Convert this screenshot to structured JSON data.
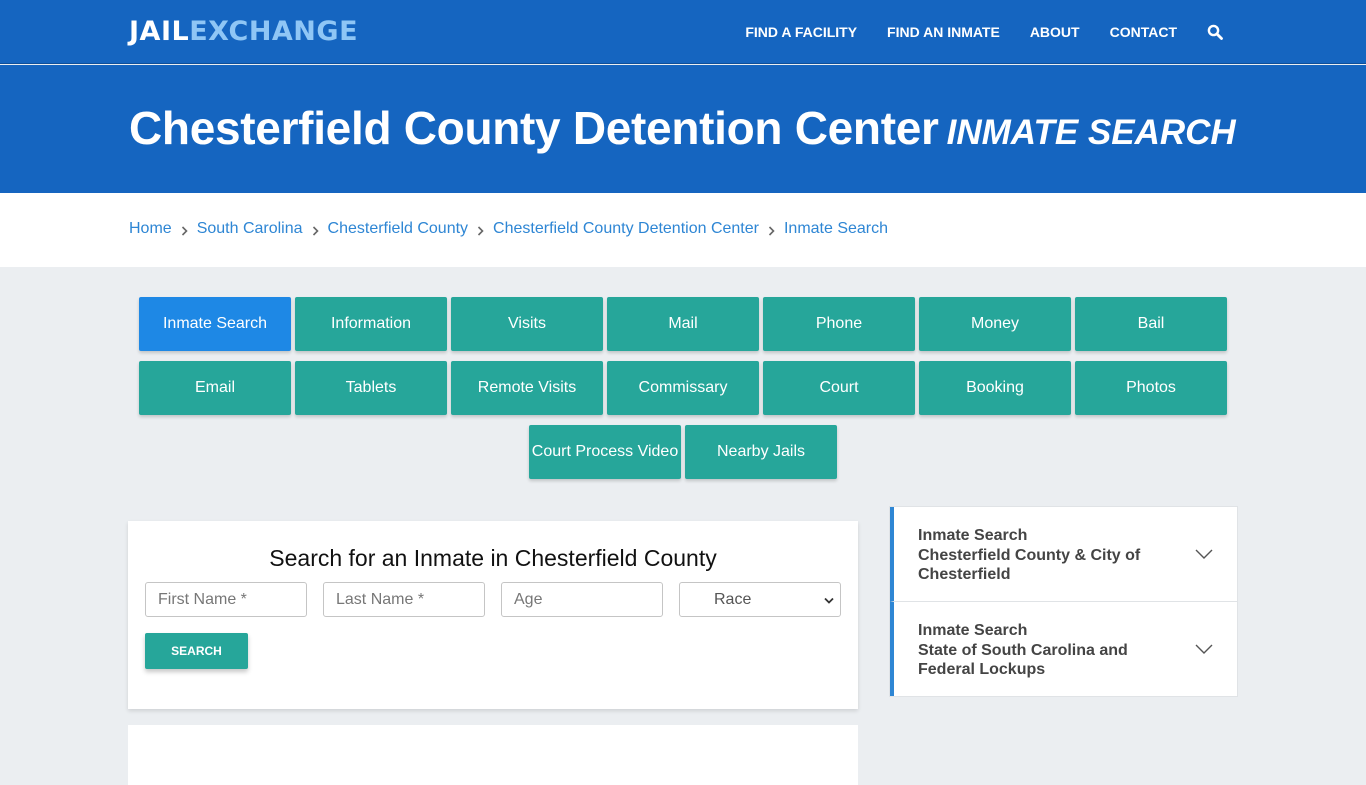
{
  "header": {
    "logo": {
      "part1": "JAIL",
      "part2": "EXCHANGE"
    },
    "nav": [
      {
        "label": "FIND A FACILITY"
      },
      {
        "label": "FIND AN INMATE"
      },
      {
        "label": "ABOUT"
      },
      {
        "label": "CONTACT"
      }
    ],
    "search_icon": "search-icon"
  },
  "hero": {
    "title": "Chesterfield County Detention Center",
    "subtitle": "INMATE SEARCH"
  },
  "breadcrumb": [
    {
      "label": "Home"
    },
    {
      "label": "South Carolina"
    },
    {
      "label": "Chesterfield County"
    },
    {
      "label": "Chesterfield County Detention Center"
    },
    {
      "label": "Inmate Search"
    }
  ],
  "tabs": {
    "row1": [
      "Inmate Search",
      "Information",
      "Visits",
      "Mail",
      "Phone",
      "Money",
      "Bail"
    ],
    "row2": [
      "Email",
      "Tablets",
      "Remote Visits",
      "Commissary",
      "Court",
      "Booking",
      "Photos"
    ],
    "row3": [
      "Court Process Video",
      "Nearby Jails"
    ],
    "active": "Inmate Search"
  },
  "search_form": {
    "title": "Search for an Inmate in Chesterfield County",
    "first_name_placeholder": "First Name *",
    "last_name_placeholder": "Last Name *",
    "age_placeholder": "Age",
    "race_selected": "Race",
    "submit_label": "SEARCH"
  },
  "sidebar": {
    "items": [
      {
        "line1": "Inmate Search",
        "line2": "Chesterfield County & City of Chesterfield"
      },
      {
        "line1": "Inmate Search",
        "line2": "State of South Carolina and Federal Lockups"
      }
    ]
  },
  "colors": {
    "brand_blue": "#1565c0",
    "logo_accent": "#8fc6f5",
    "teal": "#26a69a",
    "active_tab": "#1e88e5",
    "link": "#2e86d4",
    "page_bg": "#ebeef1"
  }
}
